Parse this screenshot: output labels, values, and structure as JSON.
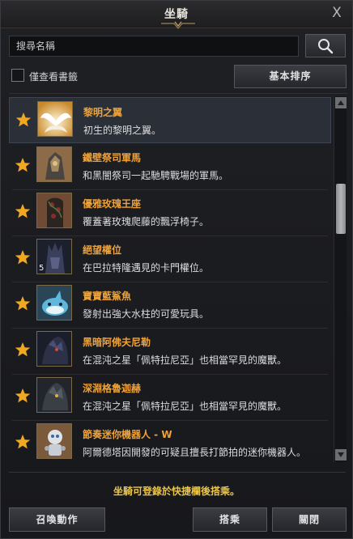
{
  "window": {
    "title": "坐騎",
    "close_glyph": "X"
  },
  "search": {
    "placeholder": "搜尋名稱",
    "icon": "search-icon"
  },
  "filter": {
    "bookmark_only_label": "僅查看書籤",
    "bookmark_only_checked": false,
    "sort_label": "基本排序"
  },
  "mounts": [
    {
      "name": "黎明之翼",
      "description": "初生的黎明之翼。",
      "favorite": true,
      "selected": true,
      "badge": ""
    },
    {
      "name": "鐵壁祭司軍馬",
      "description": "和黑闇祭司一起馳騁戰場的軍馬。",
      "favorite": true,
      "selected": false,
      "badge": ""
    },
    {
      "name": "優雅玫瑰王座",
      "description": "覆蓋著玫瑰爬藤的飄浮椅子。",
      "favorite": true,
      "selected": false,
      "badge": ""
    },
    {
      "name": "絕望權位",
      "description": "在巴拉特隆遇見的卡門權位。",
      "favorite": true,
      "selected": false,
      "badge": "5"
    },
    {
      "name": "寶寶藍鯊魚",
      "description": "發射出強大水柱的可愛玩具。",
      "favorite": true,
      "selected": false,
      "badge": ""
    },
    {
      "name": "黑暗阿佛夫尼勒",
      "description": "在混沌之星「佩特拉尼亞」也相當罕見的魔獸。",
      "favorite": true,
      "selected": false,
      "badge": ""
    },
    {
      "name": "深淵格魯迦赫",
      "description": "在混沌之星「佩特拉尼亞」也相當罕見的魔獸。",
      "favorite": true,
      "selected": false,
      "badge": ""
    },
    {
      "name": "節奏迷你機器人 - W",
      "description": "阿爾德塔因開發的可疑且擅長打節拍的迷你機器人。",
      "favorite": true,
      "selected": false,
      "badge": ""
    }
  ],
  "footer": {
    "notice": "坐騎可登錄於快捷欄後搭乘。",
    "summon_action_label": "召喚動作",
    "ride_label": "搭乘",
    "close_label": "關閉"
  },
  "colors": {
    "mount_name": "#eda23a",
    "notice": "#e8c44a",
    "favorite_star": "#f0a722"
  }
}
